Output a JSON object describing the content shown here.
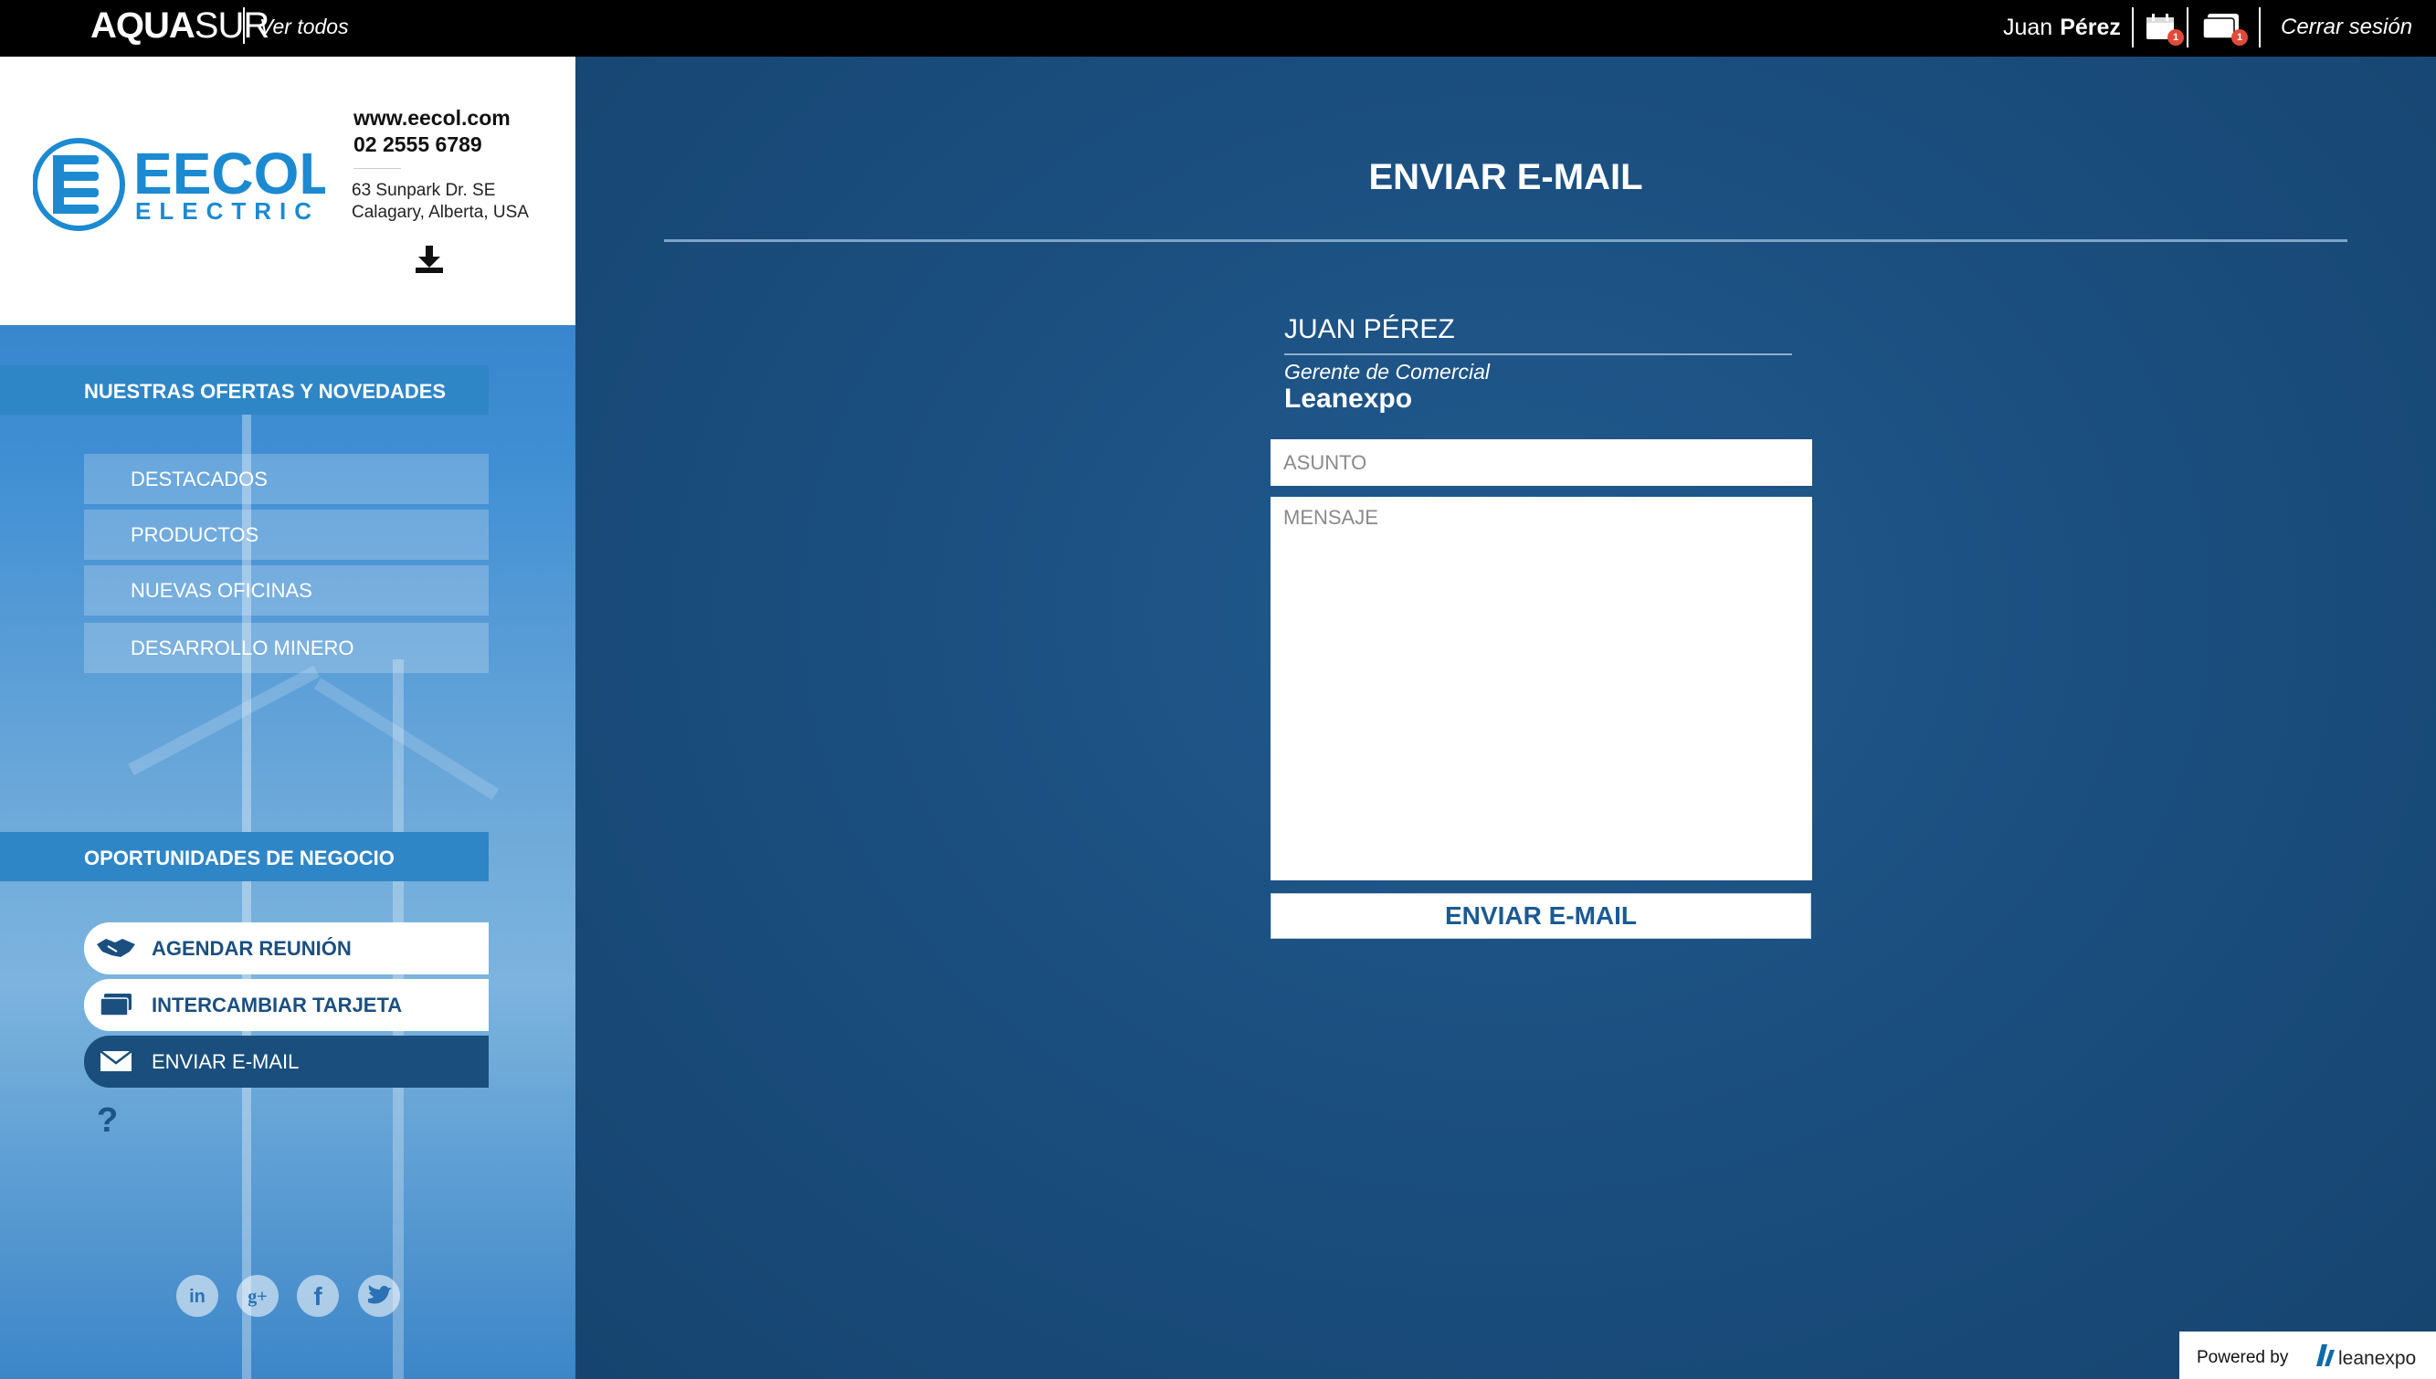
{
  "topbar": {
    "brand_bold": "AQUA",
    "brand_light": "SUR",
    "ver_todos": "Ver todos",
    "user_first": "Juan",
    "user_last": "Pérez",
    "calendar_badge": "1",
    "cards_badge": "1",
    "logout": "Cerrar sesión"
  },
  "company": {
    "logo_text": "EECOL",
    "logo_sub": "ELECTRIC",
    "website": "www.eecol.com",
    "phone": "02 2555 6789",
    "address_line1": "63 Sunpark Dr. SE",
    "address_line2": "Calagary, Alberta, USA"
  },
  "sidebar": {
    "offers_heading": "NUESTRAS OFERTAS Y NOVEDADES",
    "offers_items": [
      "DESTACADOS",
      "PRODUCTOS",
      "NUEVAS OFICINAS",
      "DESARROLLO MINERO"
    ],
    "business_heading": "OPORTUNIDADES DE NEGOCIO",
    "actions": [
      "AGENDAR REUNIÓN",
      "INTERCAMBIAR TARJETA",
      "ENVIAR E-MAIL"
    ],
    "help": "?",
    "social": [
      "in",
      "g+",
      "f",
      "twitter"
    ]
  },
  "main": {
    "title": "ENVIAR E-MAIL",
    "recipient_name": "JUAN PÉREZ",
    "recipient_role": "Gerente de Comercial",
    "recipient_company": "Leanexpo",
    "subject_placeholder": "ASUNTO",
    "message_placeholder": "MENSAJE",
    "send_label": "ENVIAR E-MAIL"
  },
  "footer": {
    "powered_by": "Powered by",
    "powered_logo": "leanexpo"
  },
  "colors": {
    "topbar": "#000000",
    "main_bg": "#1b4f80",
    "sidebar_blue": "#2f86c6",
    "active_action": "#1a4f7d",
    "badge": "#e04a3a"
  }
}
